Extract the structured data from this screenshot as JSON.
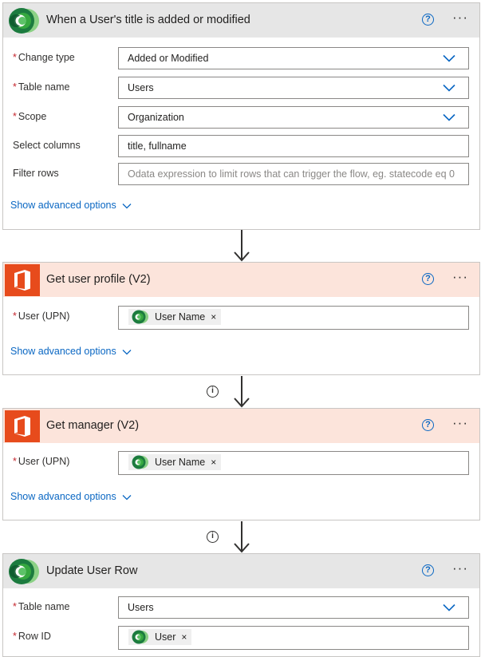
{
  "steps": [
    {
      "title": "When a User's title is added or modified",
      "fields": {
        "change_type": {
          "label": "Change type",
          "value": "Added or Modified"
        },
        "table_name": {
          "label": "Table name",
          "value": "Users"
        },
        "scope": {
          "label": "Scope",
          "value": "Organization"
        },
        "select_columns": {
          "label": "Select columns",
          "value": "title, fullname"
        },
        "filter_rows": {
          "label": "Filter rows",
          "placeholder": "Odata expression to limit rows that can trigger the flow, eg. statecode eq 0"
        }
      },
      "advanced": "Show advanced options"
    },
    {
      "title": "Get user profile (V2)",
      "fields": {
        "user": {
          "label": "User (UPN)",
          "token": "User Name"
        }
      },
      "advanced": "Show advanced options"
    },
    {
      "title": "Get manager (V2)",
      "fields": {
        "user": {
          "label": "User (UPN)",
          "token": "User Name"
        }
      },
      "advanced": "Show advanced options"
    },
    {
      "title": "Update User Row",
      "fields": {
        "table_name": {
          "label": "Table name",
          "value": "Users"
        },
        "row_id": {
          "label": "Row ID",
          "token": "User"
        }
      }
    }
  ],
  "common": {
    "help": "?",
    "more": "···",
    "required_mark": "*",
    "info": "i",
    "remove": "×"
  },
  "colors": {
    "accent": "#0a67c3",
    "dataverse_header": "#e6e6e6",
    "office_header": "#fce4db",
    "office_brand": "#e74b1c"
  },
  "icons": [
    "dataverse-logo",
    "office-logo",
    "help-icon",
    "more-icon",
    "chevron-down-icon",
    "arrow-down-icon",
    "info-icon"
  ]
}
